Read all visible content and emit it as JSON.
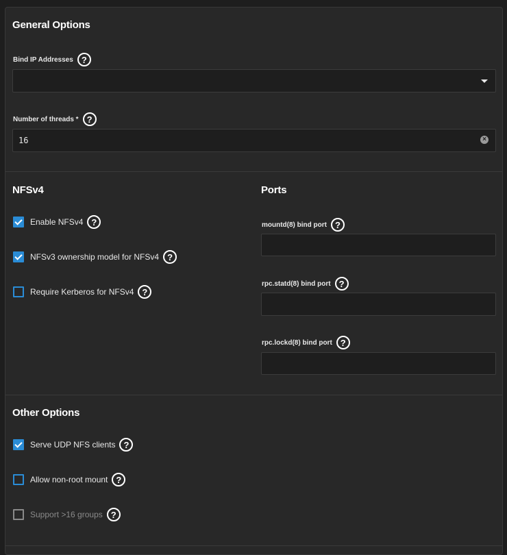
{
  "general": {
    "title": "General Options",
    "bind_ip_label": "Bind IP Addresses",
    "bind_ip_value": "",
    "threads_label": "Number of threads *",
    "threads_value": "16"
  },
  "nfsv4": {
    "title": "NFSv4",
    "options": [
      {
        "label": "Enable NFSv4",
        "checked": true,
        "disabled": false
      },
      {
        "label": "NFSv3 ownership model for NFSv4",
        "checked": true,
        "disabled": false
      },
      {
        "label": "Require Kerberos for NFSv4",
        "checked": false,
        "disabled": false
      }
    ]
  },
  "ports": {
    "title": "Ports",
    "fields": [
      {
        "label": "mountd(8) bind port",
        "value": ""
      },
      {
        "label": "rpc.statd(8) bind port",
        "value": ""
      },
      {
        "label": "rpc.lockd(8) bind port",
        "value": ""
      }
    ]
  },
  "other": {
    "title": "Other Options",
    "options": [
      {
        "label": "Serve UDP NFS clients",
        "checked": true,
        "disabled": false
      },
      {
        "label": "Allow non-root mount",
        "checked": false,
        "disabled": false
      },
      {
        "label": "Support >16 groups",
        "checked": false,
        "disabled": true
      }
    ]
  },
  "icons": {
    "help": "?",
    "clear": "×"
  },
  "colors": {
    "accent": "#2a8cd6",
    "background": "#282828",
    "field": "#1e1e1e"
  }
}
